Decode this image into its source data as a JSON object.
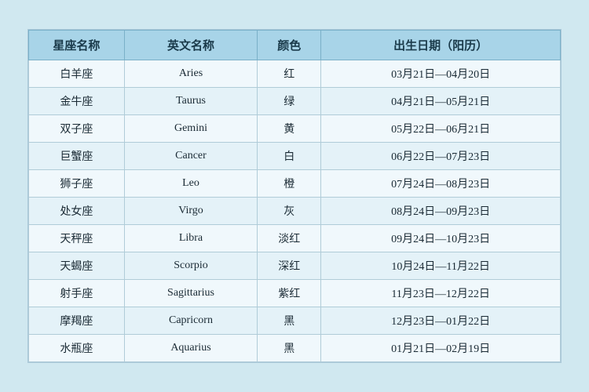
{
  "table": {
    "headers": [
      "星座名称",
      "英文名称",
      "颜色",
      "出生日期（阳历）"
    ],
    "rows": [
      {
        "zh": "白羊座",
        "en": "Aries",
        "color": "红",
        "date": "03月21日—04月20日"
      },
      {
        "zh": "金牛座",
        "en": "Taurus",
        "color": "绿",
        "date": "04月21日—05月21日"
      },
      {
        "zh": "双子座",
        "en": "Gemini",
        "color": "黄",
        "date": "05月22日—06月21日"
      },
      {
        "zh": "巨蟹座",
        "en": "Cancer",
        "color": "白",
        "date": "06月22日—07月23日"
      },
      {
        "zh": "狮子座",
        "en": "Leo",
        "color": "橙",
        "date": "07月24日—08月23日"
      },
      {
        "zh": "处女座",
        "en": "Virgo",
        "color": "灰",
        "date": "08月24日—09月23日"
      },
      {
        "zh": "天秤座",
        "en": "Libra",
        "color": "淡红",
        "date": "09月24日—10月23日"
      },
      {
        "zh": "天蝎座",
        "en": "Scorpio",
        "color": "深红",
        "date": "10月24日—11月22日"
      },
      {
        "zh": "射手座",
        "en": "Sagittarius",
        "color": "紫红",
        "date": "11月23日—12月22日"
      },
      {
        "zh": "摩羯座",
        "en": "Capricorn",
        "color": "黑",
        "date": "12月23日—01月22日"
      },
      {
        "zh": "水瓶座",
        "en": "Aquarius",
        "color": "黑",
        "date": "01月21日—02月19日"
      }
    ]
  }
}
